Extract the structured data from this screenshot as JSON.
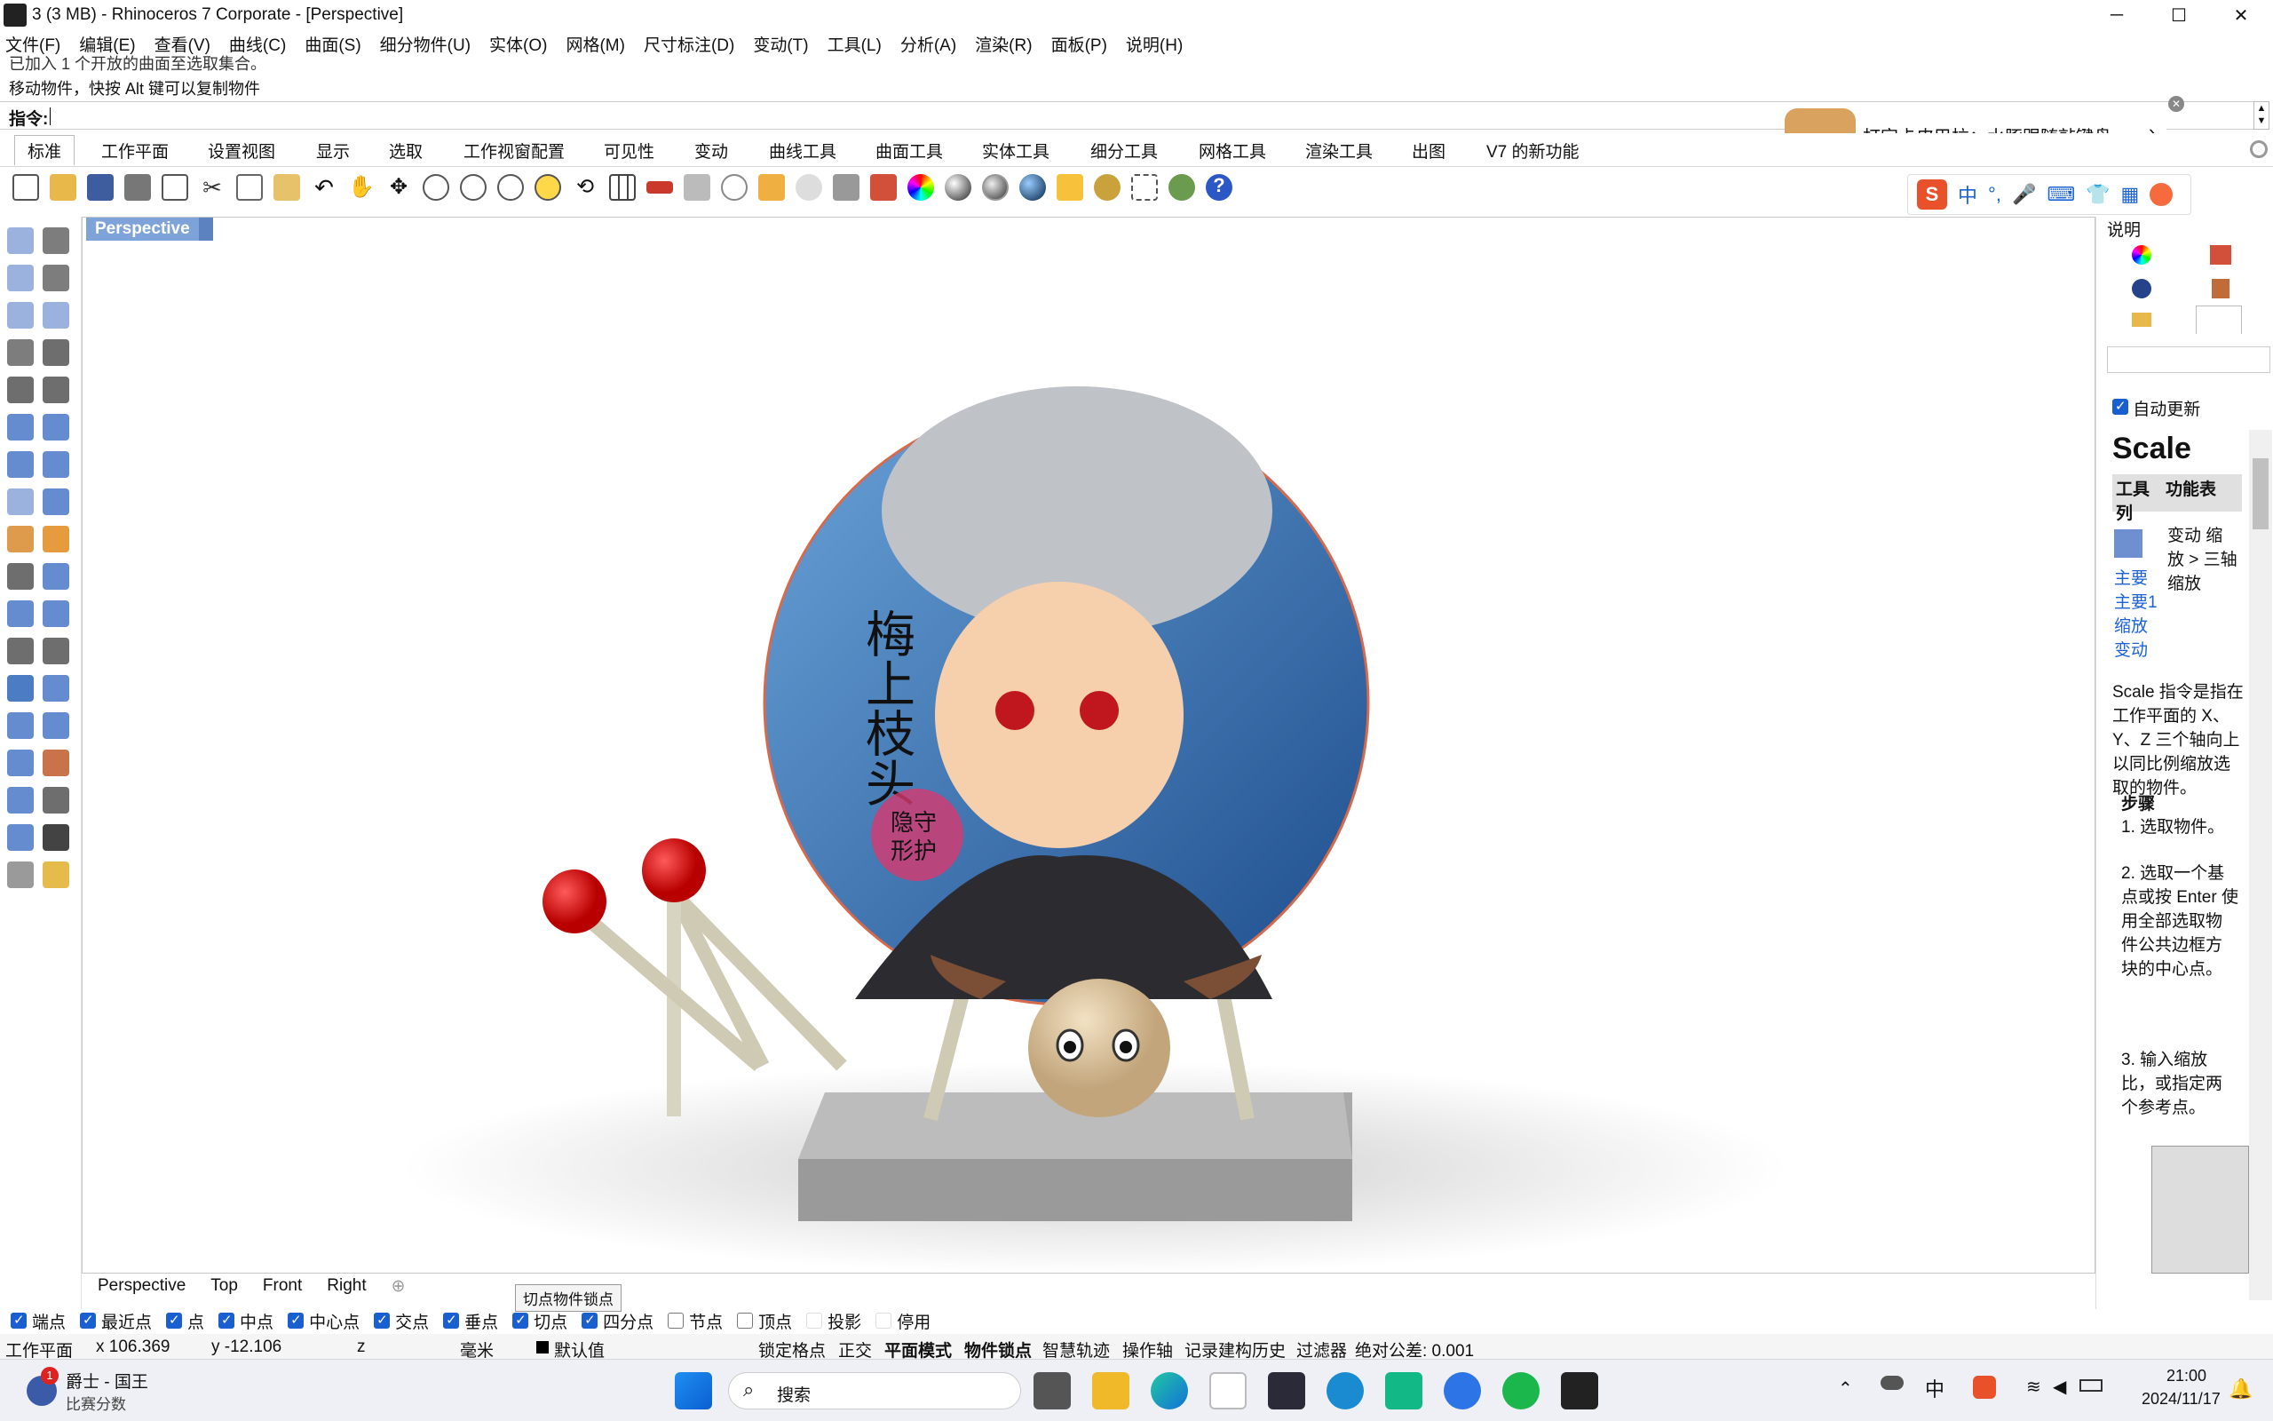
{
  "window": {
    "title": "3 (3 MB) - Rhinoceros 7 Corporate - [Perspective]",
    "minimize": "─",
    "maximize": "☐",
    "close": "✕"
  },
  "menu": [
    "文件(F)",
    "编辑(E)",
    "查看(V)",
    "曲线(C)",
    "曲面(S)",
    "细分物件(U)",
    "实体(O)",
    "网格(M)",
    "尺寸标注(D)",
    "变动(T)",
    "工具(L)",
    "分析(A)",
    "渲染(R)",
    "面板(P)",
    "说明(H)"
  ],
  "command": {
    "history_line1": "已加入 1 个开放的曲面至选取集合。",
    "history_line2": "移动物件，快按 Alt 键可以复制物件",
    "prompt_label": "指令:"
  },
  "notification": {
    "text": "打字卡皮巴拉：水豚跟随敲键盘",
    "arrow": "›",
    "close": "✕"
  },
  "tabs": [
    "标准",
    "工作平面",
    "设置视图",
    "显示",
    "选取",
    "工作视窗配置",
    "可见性",
    "变动",
    "曲线工具",
    "曲面工具",
    "实体工具",
    "细分工具",
    "网格工具",
    "渲染工具",
    "出图",
    "V7 的新功能"
  ],
  "ime": {
    "logo": "S",
    "mode": "中",
    "punct": "°,"
  },
  "viewport": {
    "label": "Perspective",
    "poster_text_1": "梅上枝头",
    "poster_text_2": "隐守",
    "poster_text_3": "形护"
  },
  "viewtabs": [
    "Perspective",
    "Top",
    "Front",
    "Right"
  ],
  "tooltip": "切点物件锁点",
  "osnaps": [
    {
      "label": "端点",
      "on": true
    },
    {
      "label": "最近点",
      "on": true
    },
    {
      "label": "点",
      "on": true
    },
    {
      "label": "中点",
      "on": true
    },
    {
      "label": "中心点",
      "on": true
    },
    {
      "label": "交点",
      "on": true
    },
    {
      "label": "垂点",
      "on": true
    },
    {
      "label": "切点",
      "on": true
    },
    {
      "label": "四分点",
      "on": true
    },
    {
      "label": "节点",
      "on": false
    },
    {
      "label": "顶点",
      "on": false
    },
    {
      "label": "投影",
      "on": false
    },
    {
      "label": "停用",
      "on": false
    }
  ],
  "status": {
    "cplane": "工作平面",
    "x": "x 106.369",
    "y": "y -12.106",
    "z": "z",
    "unit": "毫米",
    "layer": "默认值",
    "grid_snap": "锁定格点",
    "ortho": "正交",
    "planar": "平面模式",
    "osnap": "物件锁点",
    "smarttrack": "智慧轨迹",
    "gumball": "操作轴",
    "history": "记录建构历史",
    "filter": "过滤器",
    "tolerance": "绝对公差: 0.001"
  },
  "rightpanel": {
    "header": "说明",
    "auto_update": "自动更新",
    "cmd_title": "Scale",
    "col1": "工具列",
    "col2": "功能表",
    "menu_path": "变动 缩放 > 三轴缩放",
    "toolbar_path": "主要 主要1 缩放 变动",
    "description": "Scale 指令是指在工作平面的 X、Y、Z 三个轴向上以同比例缩放选取的物件。",
    "steps_title": "步骤",
    "step1": "选取物件。",
    "step2": "选取一个基点或按 Enter 使用全部选取物件公共边框方块的中心点。",
    "step3": "输入缩放比，或指定两个参考点。"
  },
  "taskbar": {
    "user_name": "爵士 - 国王",
    "user_sub": "比赛分数",
    "badge": "1",
    "search": "搜索",
    "lang": "中",
    "time": "21:00",
    "date": "2024/11/17"
  }
}
